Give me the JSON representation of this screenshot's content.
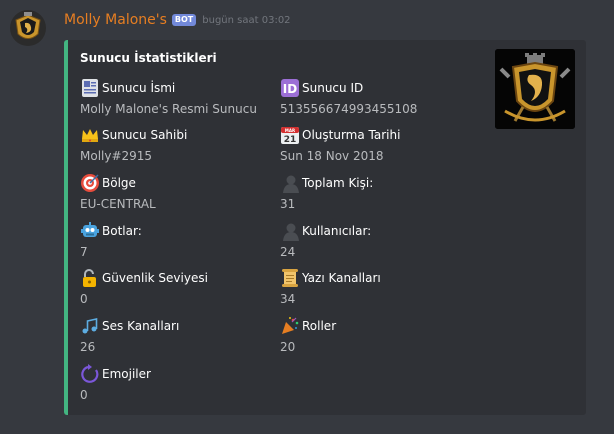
{
  "message": {
    "username": "Molly Malone's",
    "bot_tag": "BOT",
    "timestamp": "bugün saat 03:02"
  },
  "embed": {
    "title": "Sunucu İstatistikleri",
    "accent_color": "#43b581",
    "fields": [
      {
        "icon": "id-card-icon",
        "name": "Sunucu İsmi",
        "value": "Molly Malone's Resmi Sunucu"
      },
      {
        "icon": "id-badge-icon",
        "name": "Sunucu ID",
        "value": "513556674993455108"
      },
      {
        "icon": "crown-icon",
        "name": "Sunucu Sahibi",
        "value": "Molly#2915"
      },
      {
        "icon": "calendar-icon",
        "name": "Oluşturma Tarihi",
        "value": "Sun 18 Nov 2018"
      },
      {
        "icon": "target-icon",
        "name": "Bölge",
        "value": "EU-CENTRAL"
      },
      {
        "icon": "person-silhouette-icon",
        "name": "Toplam Kişi:",
        "value": "31"
      },
      {
        "icon": "robot-icon",
        "name": "Botlar:",
        "value": "7"
      },
      {
        "icon": "person-silhouette-icon",
        "name": "Kullanıcılar:",
        "value": "24"
      },
      {
        "icon": "lock-icon",
        "name": "Güvenlik Seviyesi",
        "value": "0"
      },
      {
        "icon": "scroll-icon",
        "name": "Yazı Kanalları",
        "value": "34"
      },
      {
        "icon": "music-notes-icon",
        "name": "Ses Kanalları",
        "value": "26"
      },
      {
        "icon": "party-popper-icon",
        "name": "Roller",
        "value": "20"
      },
      {
        "icon": "circle-arrow-icon",
        "name": "Emojiler",
        "value": "0"
      }
    ]
  }
}
